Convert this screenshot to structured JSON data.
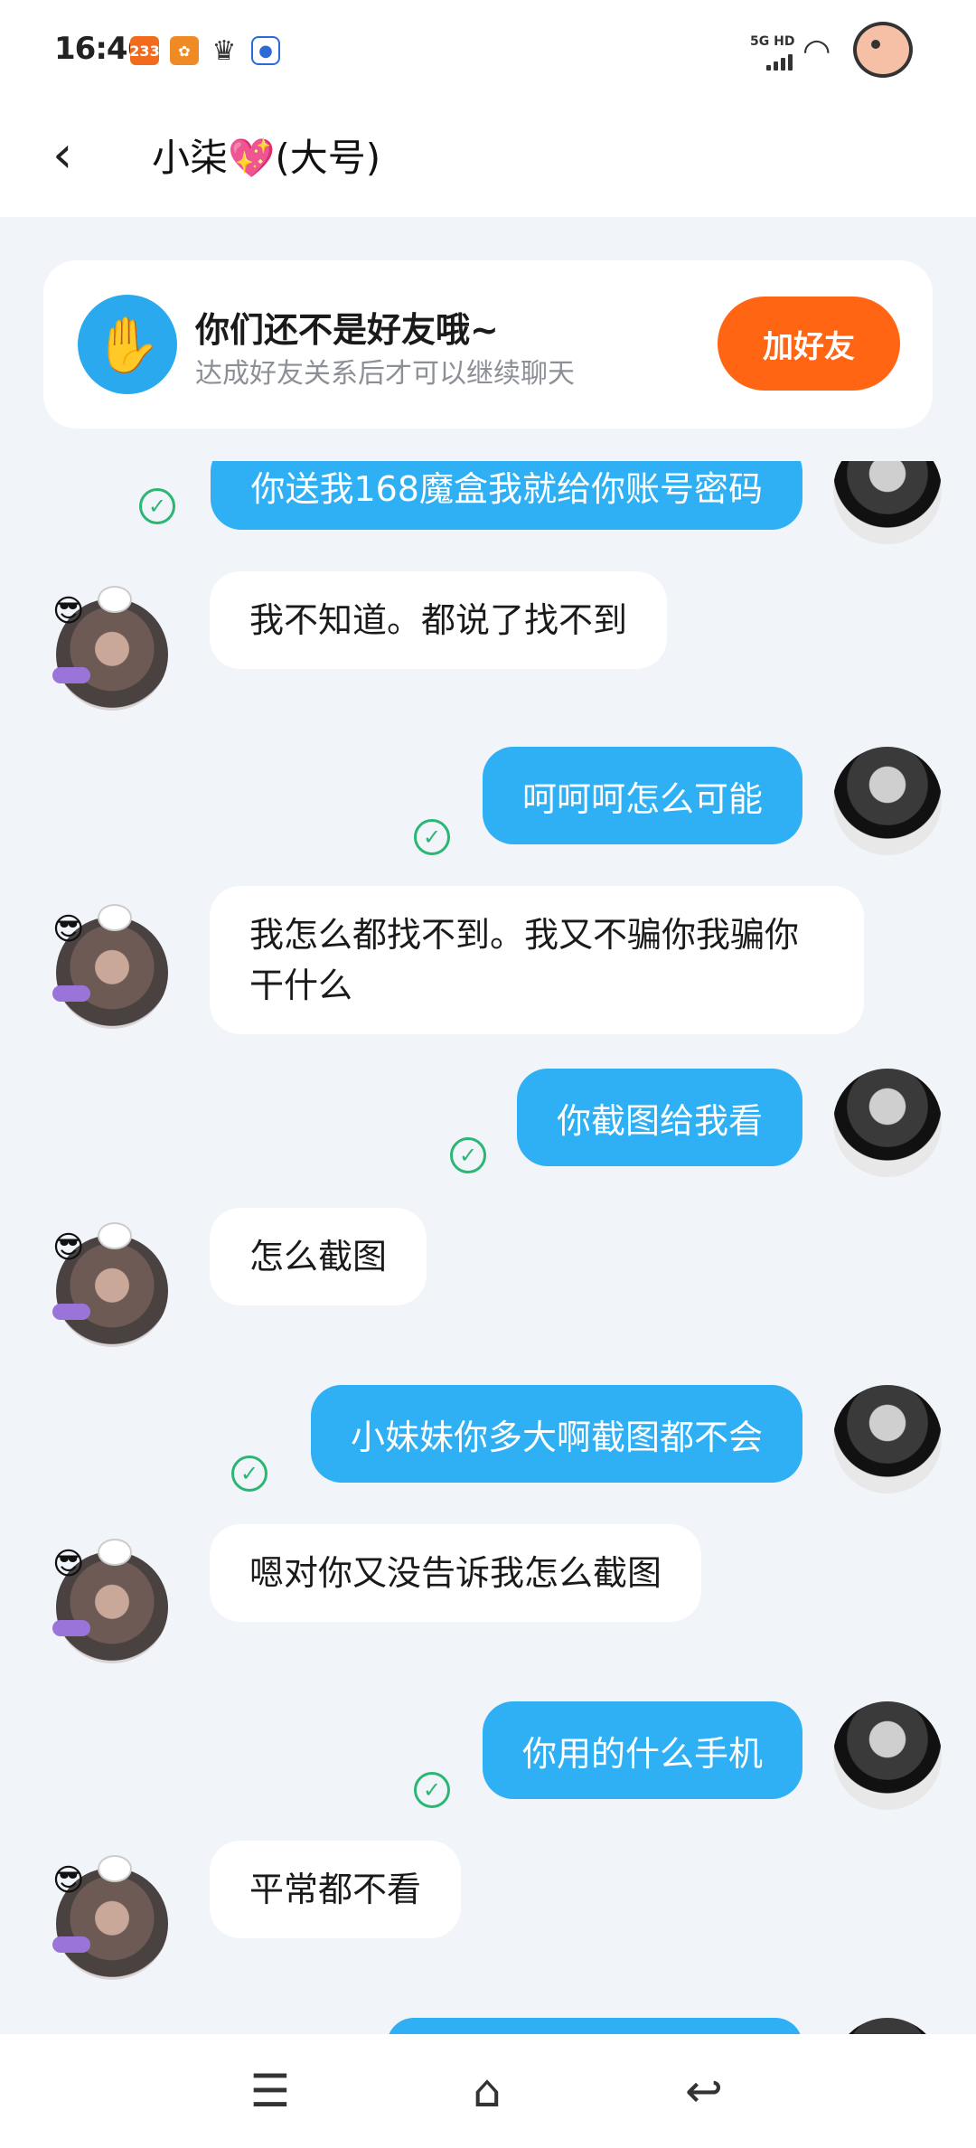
{
  "status_bar": {
    "time": "16:46",
    "icon_badge_1": "233",
    "icon_badge_2": "✿",
    "network": "5G HD"
  },
  "header": {
    "back_label": "‹",
    "title": "小柒",
    "title_emoji": "💖",
    "title_suffix": "(大号)"
  },
  "friend_banner": {
    "title": "你们还不是好友哦~",
    "subtitle": "达成好友关系后才可以继续聊天",
    "button_label": "加好友"
  },
  "messages": [
    {
      "side": "out",
      "text": "你送我168魔盒我就给你账号密码"
    },
    {
      "side": "in",
      "text": "我不知道。都说了找不到"
    },
    {
      "side": "out",
      "text": "呵呵呵怎么可能"
    },
    {
      "side": "in",
      "text": "我怎么都找不到。我又不骗你我骗你干什么"
    },
    {
      "side": "out",
      "text": "你截图给我看"
    },
    {
      "side": "in",
      "text": "怎么截图"
    },
    {
      "side": "out",
      "text": "小妹妹你多大啊截图都不会"
    },
    {
      "side": "in",
      "text": "嗯对你又没告诉我怎么截图"
    },
    {
      "side": "out",
      "text": "你用的什么手机"
    },
    {
      "side": "in",
      "text": "平常都不看"
    }
  ],
  "icons": {
    "check": "✓",
    "menu": "☰",
    "home": "⌂",
    "back": "↩"
  },
  "colors": {
    "outgoing_bubble": "#2fb0f4",
    "add_friend_button": "#ff6513",
    "read_check": "#2bb673"
  }
}
